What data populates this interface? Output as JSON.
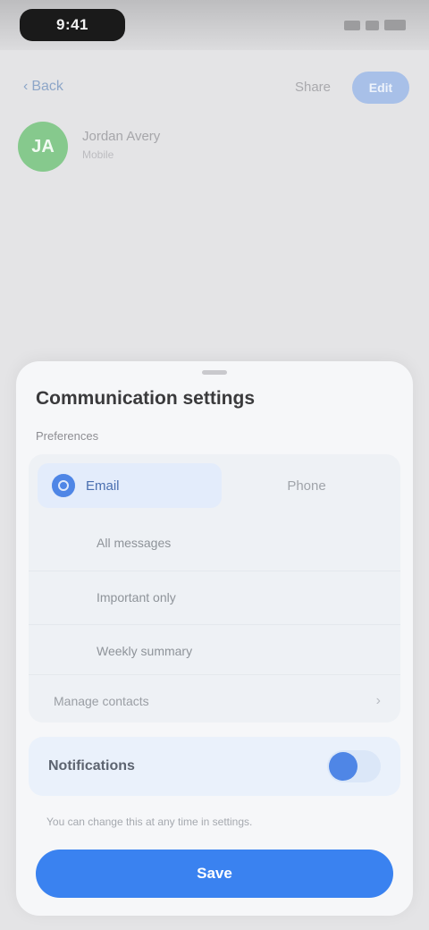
{
  "status_bar": {
    "time": "9:41"
  },
  "nav": {
    "back_label": "Back",
    "action_label": "Share",
    "pill_label": "Edit"
  },
  "contact": {
    "initials": "JA",
    "name": "Jordan Avery",
    "subtitle": "Mobile"
  },
  "sheet": {
    "title": "Communication settings",
    "section_label": "Preferences",
    "segments": [
      {
        "label": "Email",
        "selected": true
      },
      {
        "label": "Phone",
        "selected": false
      }
    ],
    "options": [
      "All messages",
      "Important only",
      "Weekly summary"
    ],
    "footer_row": "Manage contacts",
    "toggle": {
      "label": "Notifications",
      "on": true
    },
    "caption": "You can change this at any time in settings.",
    "primary_button": "Save"
  },
  "colors": {
    "accent": "#3a82f0",
    "avatar": "#86c98d",
    "sheet_bg": "#f6f7f9"
  }
}
